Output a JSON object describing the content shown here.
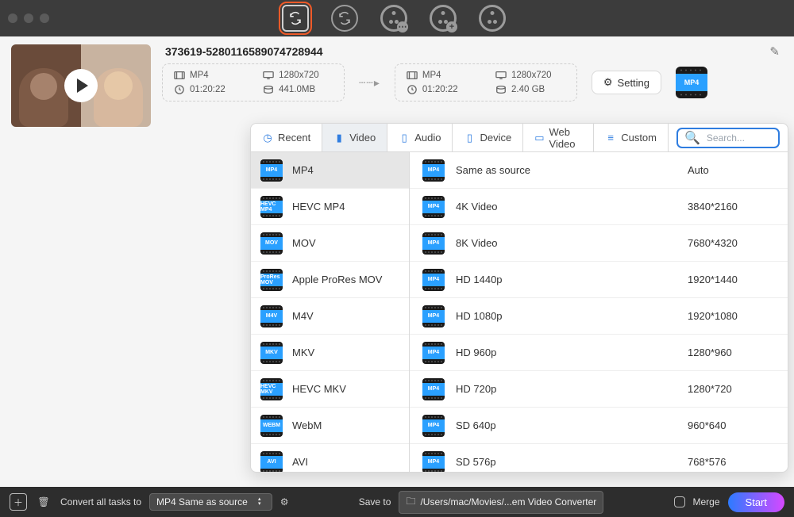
{
  "task": {
    "title": "373619-5280116589074728944",
    "source": {
      "container": "MP4",
      "resolution": "1280x720",
      "duration": "01:20:22",
      "size": "441.0MB"
    },
    "target": {
      "container": "MP4",
      "resolution": "1280x720",
      "duration": "01:20:22",
      "size": "2.40 GB"
    },
    "setting_label": "Setting",
    "badge_label": "MP4"
  },
  "popover": {
    "tabs": {
      "recent": "Recent",
      "video": "Video",
      "audio": "Audio",
      "device": "Device",
      "web": "Web Video",
      "custom": "Custom"
    },
    "search_placeholder": "Search...",
    "formats": [
      {
        "icon": "MP4",
        "label": "MP4",
        "selected": true
      },
      {
        "icon": "HEVC\nMP4",
        "label": "HEVC MP4"
      },
      {
        "icon": "MOV",
        "label": "MOV"
      },
      {
        "icon": "ProRes\nMOV",
        "label": "Apple ProRes MOV"
      },
      {
        "icon": "M4V",
        "label": "M4V"
      },
      {
        "icon": "MKV",
        "label": "MKV"
      },
      {
        "icon": "HEVC\nMKV",
        "label": "HEVC MKV"
      },
      {
        "icon": "WEBM",
        "label": "WebM"
      },
      {
        "icon": "AVI",
        "label": "AVI"
      }
    ],
    "presets": [
      {
        "label": "Same as source",
        "res": "Auto"
      },
      {
        "label": "4K Video",
        "res": "3840*2160"
      },
      {
        "label": "8K Video",
        "res": "7680*4320"
      },
      {
        "label": "HD 1440p",
        "res": "1920*1440"
      },
      {
        "label": "HD 1080p",
        "res": "1920*1080"
      },
      {
        "label": "HD 960p",
        "res": "1280*960"
      },
      {
        "label": "HD 720p",
        "res": "1280*720"
      },
      {
        "label": "SD 640p",
        "res": "960*640"
      },
      {
        "label": "SD 576p",
        "res": "768*576"
      }
    ],
    "preset_icon": "MP4"
  },
  "footer": {
    "convert_label": "Convert all tasks to",
    "convert_value": "MP4 Same as source",
    "saveto_label": "Save to",
    "saveto_path": "/Users/mac/Movies/...em Video Converter",
    "merge_label": "Merge",
    "start_label": "Start"
  }
}
